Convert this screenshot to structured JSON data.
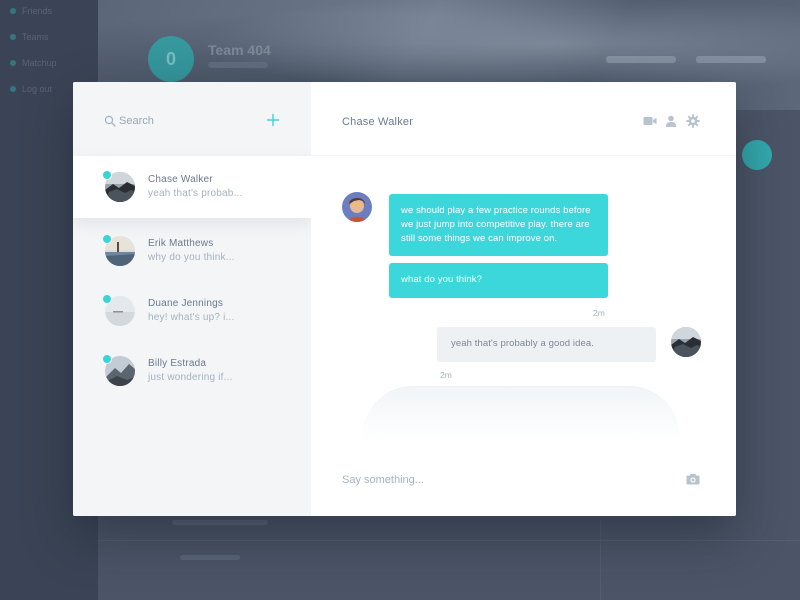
{
  "background_app": {
    "nav_items": [
      "Friends",
      "Teams",
      "Matchup",
      "Log out"
    ],
    "team_initial": "0",
    "team_name": "Team 404"
  },
  "sidebar": {
    "search": {
      "placeholder": "Search",
      "icon": "search-icon"
    },
    "add_icon": "plus-icon",
    "contacts": [
      {
        "name": "Chase Walker",
        "preview": "yeah that's probab...",
        "online": true,
        "active": true
      },
      {
        "name": "Erik Matthews",
        "preview": "why do you think...",
        "online": true,
        "active": false
      },
      {
        "name": "Duane Jennings",
        "preview": "hey! what's up? i...",
        "online": true,
        "active": false
      },
      {
        "name": "Billy Estrada",
        "preview": "just wondering if...",
        "online": true,
        "active": false
      }
    ]
  },
  "chat": {
    "title": "Chase Walker",
    "header_icons": [
      "video-camera-icon",
      "profile-icon",
      "settings-gear-icon"
    ],
    "messages": [
      {
        "direction": "incoming",
        "text": "we should play a few practice rounds before we just jump into competitive play. there are still some things we can improve on."
      },
      {
        "direction": "incoming",
        "text": "what do you think?",
        "time": "2m"
      },
      {
        "direction": "outgoing",
        "text": "yeah that's probably a good idea.",
        "time": "2m"
      }
    ],
    "composer": {
      "placeholder": "Say something...",
      "icon": "camera-icon"
    }
  },
  "colors": {
    "accent": "#3cd7db",
    "overlay": "#4a5466",
    "pane_bg": "#f3f5f7",
    "text_primary": "#6b7a8d",
    "text_muted": "#a6b2bf",
    "bubble_out": "#eef1f4"
  }
}
